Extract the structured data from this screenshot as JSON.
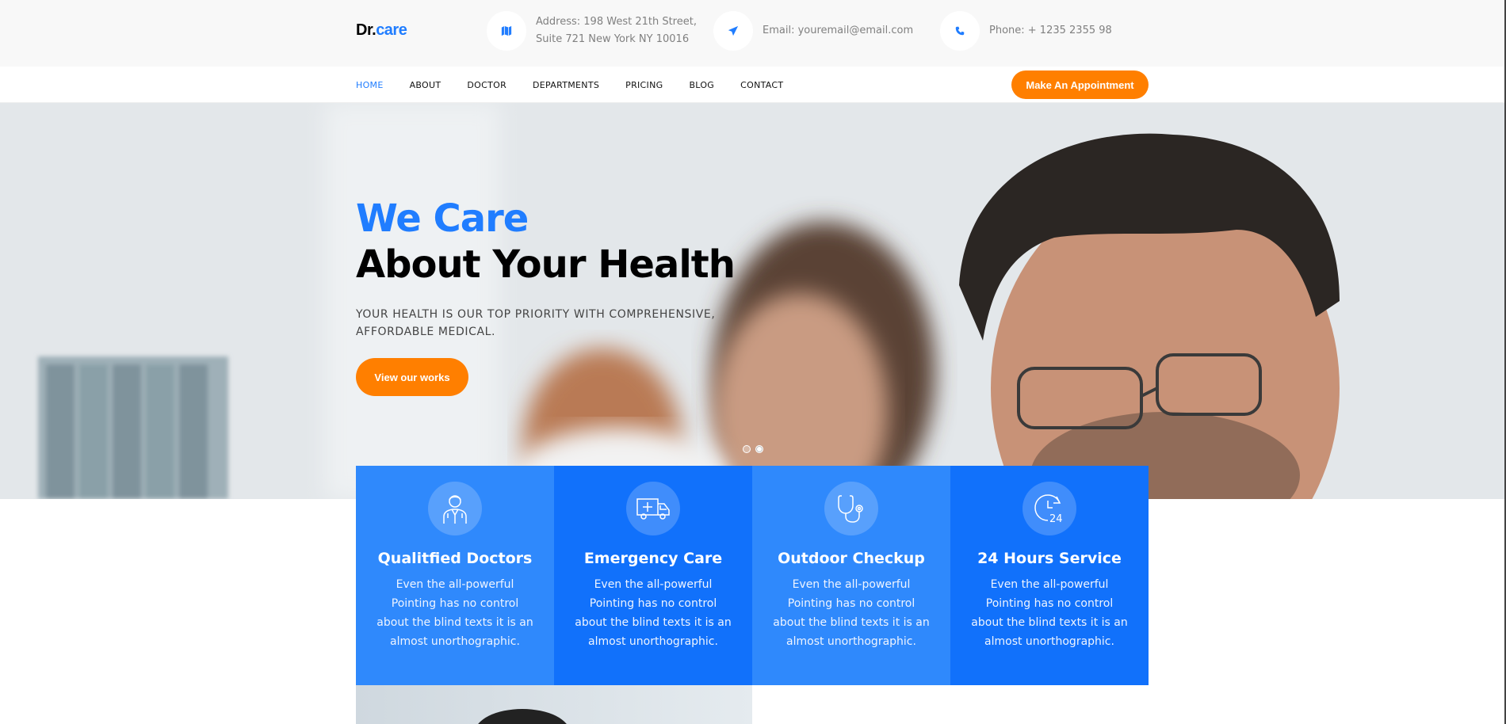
{
  "logo": {
    "prefix": "Dr.",
    "suffix": "care"
  },
  "contact": {
    "address_line1": "Address: 198 West 21th Street,",
    "address_line2": "Suite 721 New York NY 10016",
    "email": "Email: youremail@email.com",
    "phone": "Phone: + 1235 2355 98"
  },
  "nav": {
    "items": [
      "HOME",
      "ABOUT",
      "DOCTOR",
      "DEPARTMENTS",
      "PRICING",
      "BLOG",
      "CONTACT"
    ],
    "active": "HOME",
    "cta": "Make An Appointment"
  },
  "hero": {
    "title_line1": "We Care",
    "title_line2": "About Your Health",
    "subtitle": "YOUR HEALTH IS OUR TOP PRIORITY WITH COMPREHENSIVE, AFFORDABLE MEDICAL.",
    "button": "View our works",
    "slide_count": 2,
    "active_slide": 2
  },
  "services": [
    {
      "title": "Qualitfied Doctors",
      "desc": "Even the all-powerful Pointing has no control about the blind texts it is an almost unorthographic.",
      "icon": "doctor-icon"
    },
    {
      "title": "Emergency Care",
      "desc": "Even the all-powerful Pointing has no control about the blind texts it is an almost unorthographic.",
      "icon": "ambulance-icon"
    },
    {
      "title": "Outdoor Checkup",
      "desc": "Even the all-powerful Pointing has no control about the blind texts it is an almost unorthographic.",
      "icon": "stethoscope-icon"
    },
    {
      "title": "24 Hours Service",
      "desc": "Even the all-powerful Pointing has no control about the blind texts it is an almost unorthographic.",
      "icon": "clock-24-icon"
    }
  ],
  "colors": {
    "brand_blue": "#207dff",
    "accent_orange": "#ff7f00"
  }
}
